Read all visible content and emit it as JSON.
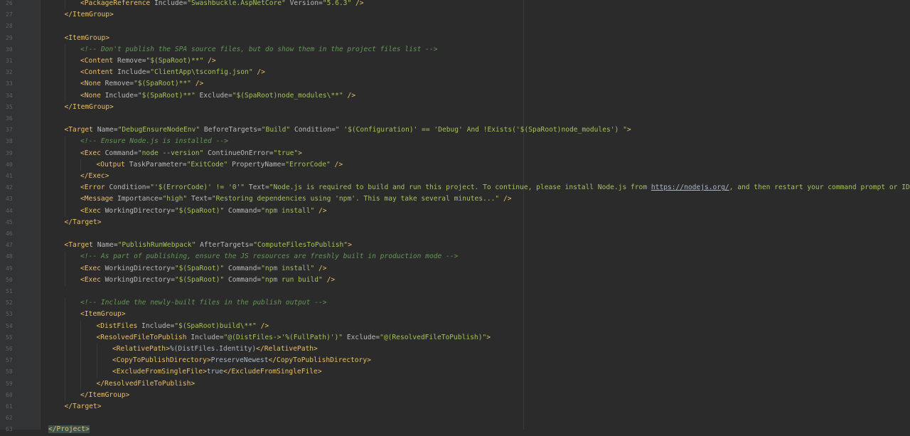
{
  "editor": {
    "lines": [
      {
        "n": "26",
        "indent": 2,
        "tokens": [
          [
            "tag",
            "<PackageReference "
          ],
          [
            "attr",
            "Include="
          ],
          [
            "val",
            "\"Swashbuckle.AspNetCore\""
          ],
          [
            "attr",
            " Version="
          ],
          [
            "val",
            "\"5.6.3\""
          ],
          [
            "tag",
            " />"
          ]
        ]
      },
      {
        "n": "27",
        "indent": 1,
        "tokens": [
          [
            "tag",
            "</ItemGroup>"
          ]
        ]
      },
      {
        "n": "28",
        "indent": 0,
        "tokens": []
      },
      {
        "n": "29",
        "indent": 1,
        "tokens": [
          [
            "tag",
            "<ItemGroup>"
          ]
        ]
      },
      {
        "n": "30",
        "indent": 2,
        "tokens": [
          [
            "cmt",
            "<!-- Don't publish the SPA source files, but do show them in the project files list -->"
          ]
        ]
      },
      {
        "n": "31",
        "indent": 2,
        "tokens": [
          [
            "tag",
            "<Content "
          ],
          [
            "attr",
            "Remove="
          ],
          [
            "val",
            "\"$(SpaRoot)**\""
          ],
          [
            "tag",
            " />"
          ]
        ]
      },
      {
        "n": "32",
        "indent": 2,
        "tokens": [
          [
            "tag",
            "<Content "
          ],
          [
            "attr",
            "Include="
          ],
          [
            "val",
            "\"ClientApp\\tsconfig.json\""
          ],
          [
            "tag",
            " />"
          ]
        ]
      },
      {
        "n": "33",
        "indent": 2,
        "tokens": [
          [
            "tag",
            "<None "
          ],
          [
            "attr",
            "Remove="
          ],
          [
            "val",
            "\"$(SpaRoot)**\""
          ],
          [
            "tag",
            " />"
          ]
        ]
      },
      {
        "n": "34",
        "indent": 2,
        "tokens": [
          [
            "tag",
            "<None "
          ],
          [
            "attr",
            "Include="
          ],
          [
            "val",
            "\"$(SpaRoot)**\""
          ],
          [
            "attr",
            " Exclude="
          ],
          [
            "val",
            "\"$(SpaRoot)node_modules\\**\""
          ],
          [
            "tag",
            " />"
          ]
        ]
      },
      {
        "n": "35",
        "indent": 1,
        "tokens": [
          [
            "tag",
            "</ItemGroup>"
          ]
        ]
      },
      {
        "n": "36",
        "indent": 0,
        "tokens": []
      },
      {
        "n": "37",
        "indent": 1,
        "tokens": [
          [
            "tag",
            "<Target "
          ],
          [
            "attr",
            "Name="
          ],
          [
            "val",
            "\"DebugEnsureNodeEnv\""
          ],
          [
            "attr",
            " BeforeTargets="
          ],
          [
            "val",
            "\"Build\""
          ],
          [
            "attr",
            " Condition="
          ],
          [
            "val",
            "\" '$(Configuration)' == 'Debug' And !Exists('$(SpaRoot)node_modules') \""
          ],
          [
            "tag",
            ">"
          ]
        ]
      },
      {
        "n": "38",
        "indent": 2,
        "tokens": [
          [
            "cmt",
            "<!-- Ensure Node.js is installed -->"
          ]
        ]
      },
      {
        "n": "39",
        "indent": 2,
        "tokens": [
          [
            "tag",
            "<Exec "
          ],
          [
            "attr",
            "Command="
          ],
          [
            "val",
            "\"node --version\""
          ],
          [
            "attr",
            " ContinueOnError="
          ],
          [
            "val",
            "\"true\""
          ],
          [
            "tag",
            ">"
          ]
        ]
      },
      {
        "n": "40",
        "indent": 3,
        "tokens": [
          [
            "tag",
            "<Output "
          ],
          [
            "attr",
            "TaskParameter="
          ],
          [
            "val",
            "\"ExitCode\""
          ],
          [
            "attr",
            " PropertyName="
          ],
          [
            "val",
            "\"ErrorCode\""
          ],
          [
            "tag",
            " />"
          ]
        ]
      },
      {
        "n": "41",
        "indent": 2,
        "tokens": [
          [
            "tag",
            "</Exec>"
          ]
        ]
      },
      {
        "n": "42",
        "indent": 2,
        "tokens": [
          [
            "tag",
            "<Error "
          ],
          [
            "attr",
            "Condition="
          ],
          [
            "val",
            "\"'$(ErrorCode)' != '0'\""
          ],
          [
            "attr",
            " Text="
          ],
          [
            "val",
            "\"Node.js is required to build and run this project. To continue, please install Node.js from "
          ],
          [
            "link",
            "https://nodejs.org/"
          ],
          [
            "val",
            ", and then restart your command prompt or IDE.\""
          ],
          [
            "tag",
            " />"
          ]
        ]
      },
      {
        "n": "43",
        "indent": 2,
        "tokens": [
          [
            "tag",
            "<Message "
          ],
          [
            "attr",
            "Importance="
          ],
          [
            "val",
            "\"high\""
          ],
          [
            "attr",
            " Text="
          ],
          [
            "val",
            "\"Restoring dependencies using 'npm'. This may take several minutes...\""
          ],
          [
            "tag",
            " />"
          ]
        ]
      },
      {
        "n": "44",
        "indent": 2,
        "tokens": [
          [
            "tag",
            "<Exec "
          ],
          [
            "attr",
            "WorkingDirectory="
          ],
          [
            "val",
            "\"$(SpaRoot)\""
          ],
          [
            "attr",
            " Command="
          ],
          [
            "val",
            "\"npm install\""
          ],
          [
            "tag",
            " />"
          ]
        ]
      },
      {
        "n": "45",
        "indent": 1,
        "tokens": [
          [
            "tag",
            "</Target>"
          ]
        ]
      },
      {
        "n": "46",
        "indent": 0,
        "tokens": []
      },
      {
        "n": "47",
        "indent": 1,
        "tokens": [
          [
            "tag",
            "<Target "
          ],
          [
            "attr",
            "Name="
          ],
          [
            "val",
            "\"PublishRunWebpack\""
          ],
          [
            "attr",
            " AfterTargets="
          ],
          [
            "val",
            "\"ComputeFilesToPublish\""
          ],
          [
            "tag",
            ">"
          ]
        ]
      },
      {
        "n": "48",
        "indent": 2,
        "tokens": [
          [
            "cmt",
            "<!-- As part of publishing, ensure the JS resources are freshly built in production mode -->"
          ]
        ]
      },
      {
        "n": "49",
        "indent": 2,
        "tokens": [
          [
            "tag",
            "<Exec "
          ],
          [
            "attr",
            "WorkingDirectory="
          ],
          [
            "val",
            "\"$(SpaRoot)\""
          ],
          [
            "attr",
            " Command="
          ],
          [
            "val",
            "\"npm install\""
          ],
          [
            "tag",
            " />"
          ]
        ]
      },
      {
        "n": "50",
        "indent": 2,
        "tokens": [
          [
            "tag",
            "<Exec "
          ],
          [
            "attr",
            "WorkingDirectory="
          ],
          [
            "val",
            "\"$(SpaRoot)\""
          ],
          [
            "attr",
            " Command="
          ],
          [
            "val",
            "\"npm run build\""
          ],
          [
            "tag",
            " />"
          ]
        ]
      },
      {
        "n": "51",
        "indent": 0,
        "tokens": []
      },
      {
        "n": "52",
        "indent": 2,
        "tokens": [
          [
            "cmt",
            "<!-- Include the newly-built files in the publish output -->"
          ]
        ]
      },
      {
        "n": "53",
        "indent": 2,
        "tokens": [
          [
            "tag",
            "<ItemGroup>"
          ]
        ]
      },
      {
        "n": "54",
        "indent": 3,
        "tokens": [
          [
            "tag",
            "<DistFiles "
          ],
          [
            "attr",
            "Include="
          ],
          [
            "val",
            "\"$(SpaRoot)build\\**\""
          ],
          [
            "tag",
            " />"
          ]
        ]
      },
      {
        "n": "55",
        "indent": 3,
        "tokens": [
          [
            "tag",
            "<ResolvedFileToPublish "
          ],
          [
            "attr",
            "Include="
          ],
          [
            "val",
            "\"@(DistFiles->'%(FullPath)')\""
          ],
          [
            "attr",
            " Exclude="
          ],
          [
            "val",
            "\"@(ResolvedFileToPublish)\""
          ],
          [
            "tag",
            ">"
          ]
        ]
      },
      {
        "n": "56",
        "indent": 4,
        "tokens": [
          [
            "tag",
            "<RelativePath>"
          ],
          [
            "text",
            "%(DistFiles.Identity)"
          ],
          [
            "tag",
            "</RelativePath>"
          ]
        ]
      },
      {
        "n": "57",
        "indent": 4,
        "tokens": [
          [
            "tag",
            "<CopyToPublishDirectory>"
          ],
          [
            "text",
            "PreserveNewest"
          ],
          [
            "tag",
            "</CopyToPublishDirectory>"
          ]
        ]
      },
      {
        "n": "58",
        "indent": 4,
        "tokens": [
          [
            "tag",
            "<ExcludeFromSingleFile>"
          ],
          [
            "text",
            "true"
          ],
          [
            "tag",
            "</ExcludeFromSingleFile>"
          ]
        ]
      },
      {
        "n": "59",
        "indent": 3,
        "tokens": [
          [
            "tag",
            "</ResolvedFileToPublish>"
          ]
        ]
      },
      {
        "n": "60",
        "indent": 2,
        "tokens": [
          [
            "tag",
            "</ItemGroup>"
          ]
        ]
      },
      {
        "n": "61",
        "indent": 1,
        "tokens": [
          [
            "tag",
            "</Target>"
          ]
        ]
      },
      {
        "n": "62",
        "indent": 0,
        "tokens": []
      },
      {
        "n": "63",
        "indent": 0,
        "tokens": [
          [
            "hl",
            "</Project>"
          ]
        ]
      }
    ]
  }
}
